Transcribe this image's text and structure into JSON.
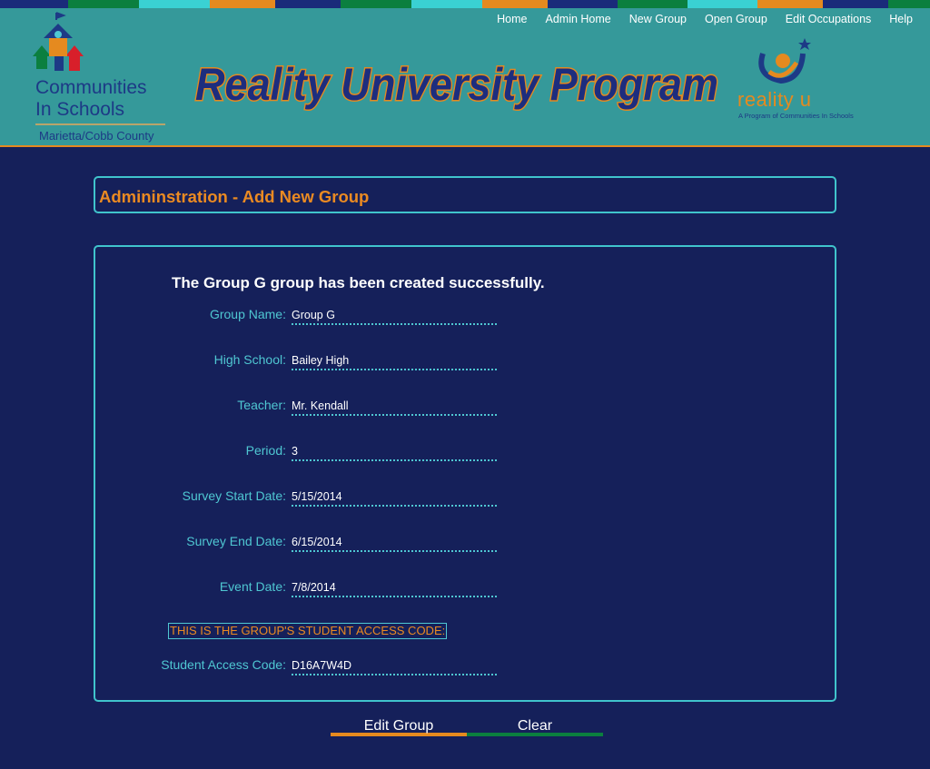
{
  "colors": {
    "background": "#15205a",
    "header_bg": "#35999a",
    "accent_orange": "#ea8a22",
    "accent_cyan": "#4fc7d2",
    "accent_green": "#0b7f3f",
    "stripe": [
      "#1a2b7a",
      "#0b7f3f",
      "#3ad1d3",
      "#e58a1f",
      "#1a2b7a",
      "#0b7f3f",
      "#3ad1d3",
      "#e58a1f",
      "#1a2b7a",
      "#0b7f3f",
      "#3ad1d3",
      "#e58a1f",
      "#1a2b7a"
    ]
  },
  "nav": {
    "home": "Home",
    "admin_home": "Admin Home",
    "new_group": "New Group",
    "open_group": "Open Group",
    "edit_occupations": "Edit Occupations",
    "help": "Help"
  },
  "header": {
    "cis_line1": "Communities",
    "cis_line2": "In Schools",
    "county": "Marietta/Cobb County",
    "banner_title": "Reality University Program",
    "ru_brand": "reality u",
    "ru_tagline": "A Program of Communities In Schools"
  },
  "page": {
    "title": "Admininstration - Add New Group",
    "success_message": "The Group G group has been created successfully."
  },
  "fields": {
    "group_name": {
      "label": "Group Name:",
      "value": "Group G"
    },
    "high_school": {
      "label": "High School:",
      "value": "Bailey High"
    },
    "teacher": {
      "label": "Teacher:",
      "value": "Mr. Kendall"
    },
    "period": {
      "label": "Period:",
      "value": "3"
    },
    "survey_start": {
      "label": "Survey Start Date:",
      "value": "5/15/2014"
    },
    "survey_end": {
      "label": "Survey End Date:",
      "value": "6/15/2014"
    },
    "event_date": {
      "label": "Event Date:",
      "value": "7/8/2014"
    },
    "access_notice": "THIS IS THE GROUP'S STUDENT ACCESS CODE:",
    "access_code": {
      "label": "Student Access Code:",
      "value": "D16A7W4D"
    }
  },
  "buttons": {
    "edit_group": "Edit Group",
    "clear": "Clear"
  }
}
